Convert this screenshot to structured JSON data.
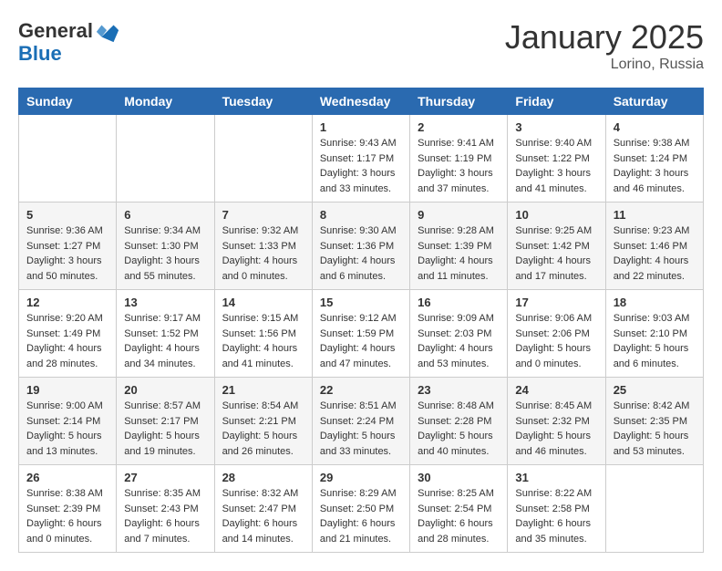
{
  "header": {
    "logo_general": "General",
    "logo_blue": "Blue",
    "month_title": "January 2025",
    "location": "Lorino, Russia"
  },
  "days_of_week": [
    "Sunday",
    "Monday",
    "Tuesday",
    "Wednesday",
    "Thursday",
    "Friday",
    "Saturday"
  ],
  "weeks": [
    [
      {
        "day": "",
        "info": ""
      },
      {
        "day": "",
        "info": ""
      },
      {
        "day": "",
        "info": ""
      },
      {
        "day": "1",
        "info": "Sunrise: 9:43 AM\nSunset: 1:17 PM\nDaylight: 3 hours\nand 33 minutes."
      },
      {
        "day": "2",
        "info": "Sunrise: 9:41 AM\nSunset: 1:19 PM\nDaylight: 3 hours\nand 37 minutes."
      },
      {
        "day": "3",
        "info": "Sunrise: 9:40 AM\nSunset: 1:22 PM\nDaylight: 3 hours\nand 41 minutes."
      },
      {
        "day": "4",
        "info": "Sunrise: 9:38 AM\nSunset: 1:24 PM\nDaylight: 3 hours\nand 46 minutes."
      }
    ],
    [
      {
        "day": "5",
        "info": "Sunrise: 9:36 AM\nSunset: 1:27 PM\nDaylight: 3 hours\nand 50 minutes."
      },
      {
        "day": "6",
        "info": "Sunrise: 9:34 AM\nSunset: 1:30 PM\nDaylight: 3 hours\nand 55 minutes."
      },
      {
        "day": "7",
        "info": "Sunrise: 9:32 AM\nSunset: 1:33 PM\nDaylight: 4 hours\nand 0 minutes."
      },
      {
        "day": "8",
        "info": "Sunrise: 9:30 AM\nSunset: 1:36 PM\nDaylight: 4 hours\nand 6 minutes."
      },
      {
        "day": "9",
        "info": "Sunrise: 9:28 AM\nSunset: 1:39 PM\nDaylight: 4 hours\nand 11 minutes."
      },
      {
        "day": "10",
        "info": "Sunrise: 9:25 AM\nSunset: 1:42 PM\nDaylight: 4 hours\nand 17 minutes."
      },
      {
        "day": "11",
        "info": "Sunrise: 9:23 AM\nSunset: 1:46 PM\nDaylight: 4 hours\nand 22 minutes."
      }
    ],
    [
      {
        "day": "12",
        "info": "Sunrise: 9:20 AM\nSunset: 1:49 PM\nDaylight: 4 hours\nand 28 minutes."
      },
      {
        "day": "13",
        "info": "Sunrise: 9:17 AM\nSunset: 1:52 PM\nDaylight: 4 hours\nand 34 minutes."
      },
      {
        "day": "14",
        "info": "Sunrise: 9:15 AM\nSunset: 1:56 PM\nDaylight: 4 hours\nand 41 minutes."
      },
      {
        "day": "15",
        "info": "Sunrise: 9:12 AM\nSunset: 1:59 PM\nDaylight: 4 hours\nand 47 minutes."
      },
      {
        "day": "16",
        "info": "Sunrise: 9:09 AM\nSunset: 2:03 PM\nDaylight: 4 hours\nand 53 minutes."
      },
      {
        "day": "17",
        "info": "Sunrise: 9:06 AM\nSunset: 2:06 PM\nDaylight: 5 hours\nand 0 minutes."
      },
      {
        "day": "18",
        "info": "Sunrise: 9:03 AM\nSunset: 2:10 PM\nDaylight: 5 hours\nand 6 minutes."
      }
    ],
    [
      {
        "day": "19",
        "info": "Sunrise: 9:00 AM\nSunset: 2:14 PM\nDaylight: 5 hours\nand 13 minutes."
      },
      {
        "day": "20",
        "info": "Sunrise: 8:57 AM\nSunset: 2:17 PM\nDaylight: 5 hours\nand 19 minutes."
      },
      {
        "day": "21",
        "info": "Sunrise: 8:54 AM\nSunset: 2:21 PM\nDaylight: 5 hours\nand 26 minutes."
      },
      {
        "day": "22",
        "info": "Sunrise: 8:51 AM\nSunset: 2:24 PM\nDaylight: 5 hours\nand 33 minutes."
      },
      {
        "day": "23",
        "info": "Sunrise: 8:48 AM\nSunset: 2:28 PM\nDaylight: 5 hours\nand 40 minutes."
      },
      {
        "day": "24",
        "info": "Sunrise: 8:45 AM\nSunset: 2:32 PM\nDaylight: 5 hours\nand 46 minutes."
      },
      {
        "day": "25",
        "info": "Sunrise: 8:42 AM\nSunset: 2:35 PM\nDaylight: 5 hours\nand 53 minutes."
      }
    ],
    [
      {
        "day": "26",
        "info": "Sunrise: 8:38 AM\nSunset: 2:39 PM\nDaylight: 6 hours\nand 0 minutes."
      },
      {
        "day": "27",
        "info": "Sunrise: 8:35 AM\nSunset: 2:43 PM\nDaylight: 6 hours\nand 7 minutes."
      },
      {
        "day": "28",
        "info": "Sunrise: 8:32 AM\nSunset: 2:47 PM\nDaylight: 6 hours\nand 14 minutes."
      },
      {
        "day": "29",
        "info": "Sunrise: 8:29 AM\nSunset: 2:50 PM\nDaylight: 6 hours\nand 21 minutes."
      },
      {
        "day": "30",
        "info": "Sunrise: 8:25 AM\nSunset: 2:54 PM\nDaylight: 6 hours\nand 28 minutes."
      },
      {
        "day": "31",
        "info": "Sunrise: 8:22 AM\nSunset: 2:58 PM\nDaylight: 6 hours\nand 35 minutes."
      },
      {
        "day": "",
        "info": ""
      }
    ]
  ]
}
